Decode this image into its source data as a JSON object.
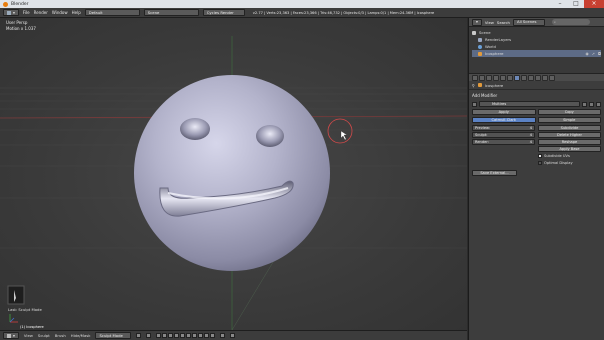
{
  "window": {
    "title": "Blender",
    "controls": [
      "–",
      "□",
      "×"
    ]
  },
  "info_header": {
    "menus": [
      "File",
      "Render",
      "Window",
      "Help"
    ],
    "layout": "Default",
    "scene": "Scene",
    "engine": "Cycles Render",
    "stats": "v2.77 | Verts:23,363 | Faces:23,366 | Tris:46,732 | Objects:0/3 | Lamps:0/1 | Mem:24.36M | Icosphere"
  },
  "viewport": {
    "view_name": "User Persp",
    "subinfo": "Motion x 1.037",
    "last_op": "Last: Sculpt Mode",
    "object_label": "(1) Icosphere"
  },
  "viewport_footer": {
    "menus": [
      "View",
      "Sculpt",
      "Brush",
      "Hide/Mask"
    ],
    "mode": "Sculpt Mode"
  },
  "outliner": {
    "tabs": [
      "View",
      "Search"
    ],
    "filter": "All Scenes",
    "items": [
      {
        "label": "Scene",
        "color": "#c9c9c9"
      },
      {
        "label": "RenderLayers",
        "color": "#9aa7c1"
      },
      {
        "label": "World",
        "color": "#6aa0d8"
      },
      {
        "label": "Icosphere",
        "color": "#e29a3b"
      }
    ]
  },
  "properties": {
    "object_name": "Icosphere",
    "add_modifier": "Add Modifier",
    "modifier_name": "Multires",
    "apply_label": "Apply",
    "copy_label": "Copy",
    "catmull_label": "Catmull-Clark",
    "simple_label": "Simple",
    "fields": [
      {
        "label": "Preview:",
        "value": "4"
      },
      {
        "label": "Sculpt:",
        "value": "4"
      },
      {
        "label": "Render:",
        "value": "4"
      }
    ],
    "buttons_right": [
      "Subdivide",
      "Delete Higher",
      "Reshape",
      "Apply Base"
    ],
    "checkbox_uvs": "Subdivide UVs",
    "checkbox_optimal": "Optimal Display",
    "save_external": "Save External..."
  }
}
